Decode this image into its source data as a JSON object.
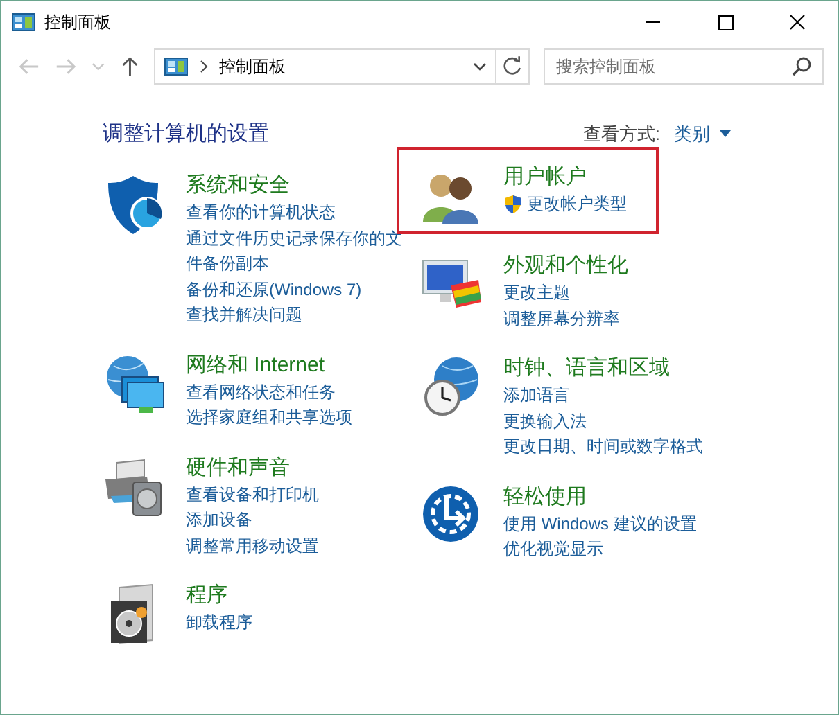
{
  "window": {
    "title": "控制面板"
  },
  "address_bar": {
    "breadcrumb": "控制面板"
  },
  "search": {
    "placeholder": "搜索控制面板"
  },
  "heading": "调整计算机的设置",
  "view_by": {
    "label": "查看方式:",
    "value": "类别"
  },
  "columns": [
    {
      "categories": [
        {
          "title": "系统和安全",
          "highlighted": false,
          "links": [
            {
              "text": "查看你的计算机状态",
              "shield": false
            },
            {
              "text": "通过文件历史记录保存你的文件备份副本",
              "shield": false
            },
            {
              "text": "备份和还原(Windows 7)",
              "shield": false
            },
            {
              "text": "查找并解决问题",
              "shield": false
            }
          ]
        },
        {
          "title": "网络和 Internet",
          "highlighted": false,
          "links": [
            {
              "text": "查看网络状态和任务",
              "shield": false
            },
            {
              "text": "选择家庭组和共享选项",
              "shield": false
            }
          ]
        },
        {
          "title": "硬件和声音",
          "highlighted": false,
          "links": [
            {
              "text": "查看设备和打印机",
              "shield": false
            },
            {
              "text": "添加设备",
              "shield": false
            },
            {
              "text": "调整常用移动设置",
              "shield": false
            }
          ]
        },
        {
          "title": "程序",
          "highlighted": false,
          "links": [
            {
              "text": "卸载程序",
              "shield": false
            }
          ]
        }
      ]
    },
    {
      "categories": [
        {
          "title": "用户帐户",
          "highlighted": true,
          "links": [
            {
              "text": "更改帐户类型",
              "shield": true
            }
          ]
        },
        {
          "title": "外观和个性化",
          "highlighted": false,
          "links": [
            {
              "text": "更改主题",
              "shield": false
            },
            {
              "text": "调整屏幕分辨率",
              "shield": false
            }
          ]
        },
        {
          "title": "时钟、语言和区域",
          "highlighted": false,
          "links": [
            {
              "text": "添加语言",
              "shield": false
            },
            {
              "text": "更换输入法",
              "shield": false
            },
            {
              "text": "更改日期、时间或数字格式",
              "shield": false
            }
          ]
        },
        {
          "title": "轻松使用",
          "highlighted": false,
          "links": [
            {
              "text": "使用 Windows 建议的设置",
              "shield": false
            },
            {
              "text": "优化视觉显示",
              "shield": false
            }
          ]
        }
      ]
    }
  ]
}
